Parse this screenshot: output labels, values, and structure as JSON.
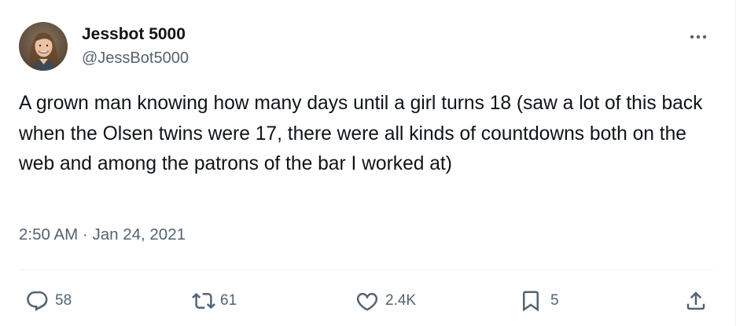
{
  "author": {
    "display_name": "Jessbot 5000",
    "handle": "@JessBot5000"
  },
  "tweet": {
    "text": "A grown man knowing how many days until a girl turns 18 (saw a lot of this back when the Olsen twins were 17, there were all kinds of countdowns both on the web and among the patrons of the bar I worked at)",
    "time": "2:50 AM",
    "separator": "·",
    "date": "Jan 24, 2021"
  },
  "actions": {
    "replies": "58",
    "reposts": "61",
    "likes": "2.4K",
    "bookmarks": "5"
  },
  "icons": {
    "more": "more-horizontal-icon",
    "reply": "reply-bubble-icon",
    "repost": "repost-arrows-icon",
    "like": "heart-icon",
    "bookmark": "bookmark-icon",
    "share": "share-upload-icon"
  },
  "colors": {
    "text_primary": "#0f1419",
    "text_secondary": "#536471",
    "divider": "#eff3f4"
  }
}
